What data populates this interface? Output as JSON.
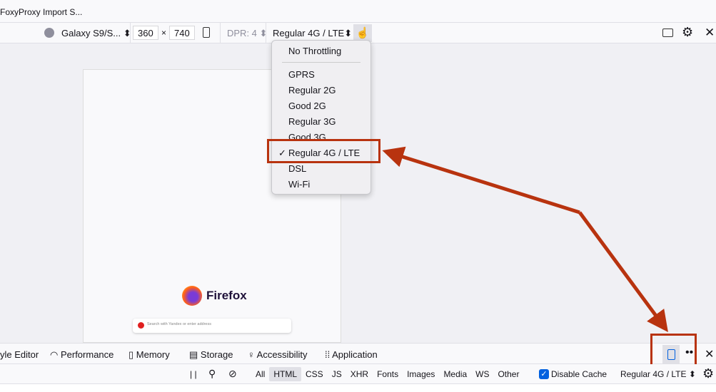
{
  "tab": {
    "title": "FoxyProxy Import S..."
  },
  "rdm": {
    "device": "Galaxy S9/S...",
    "width": "360",
    "times": "×",
    "height": "740",
    "dpr": "DPR: 4",
    "throttle": "Regular 4G / LTE"
  },
  "menu": {
    "items": [
      "No Throttling",
      "GPRS",
      "Regular 2G",
      "Good 2G",
      "Regular 3G",
      "Good 3G",
      "Regular 4G / LTE",
      "DSL",
      "Wi-Fi"
    ],
    "selected": "Regular 4G / LTE",
    "check": "✓"
  },
  "viewport": {
    "brand": "Firefox",
    "search_placeholder": "Search with Yandex or enter address"
  },
  "devtools": {
    "tabs": [
      "yle Editor",
      "Performance",
      "Memory",
      "Storage",
      "Accessibility",
      "Application"
    ]
  },
  "network": {
    "filters": [
      "All",
      "HTML",
      "CSS",
      "JS",
      "XHR",
      "Fonts",
      "Images",
      "Media",
      "WS",
      "Other"
    ],
    "active_filter": "HTML",
    "disable_cache": "Disable Cache",
    "disable_cache_checked": true,
    "throttle": "Regular 4G / LTE"
  },
  "colors": {
    "annotation": "#b8330f",
    "accent": "#0060df"
  }
}
